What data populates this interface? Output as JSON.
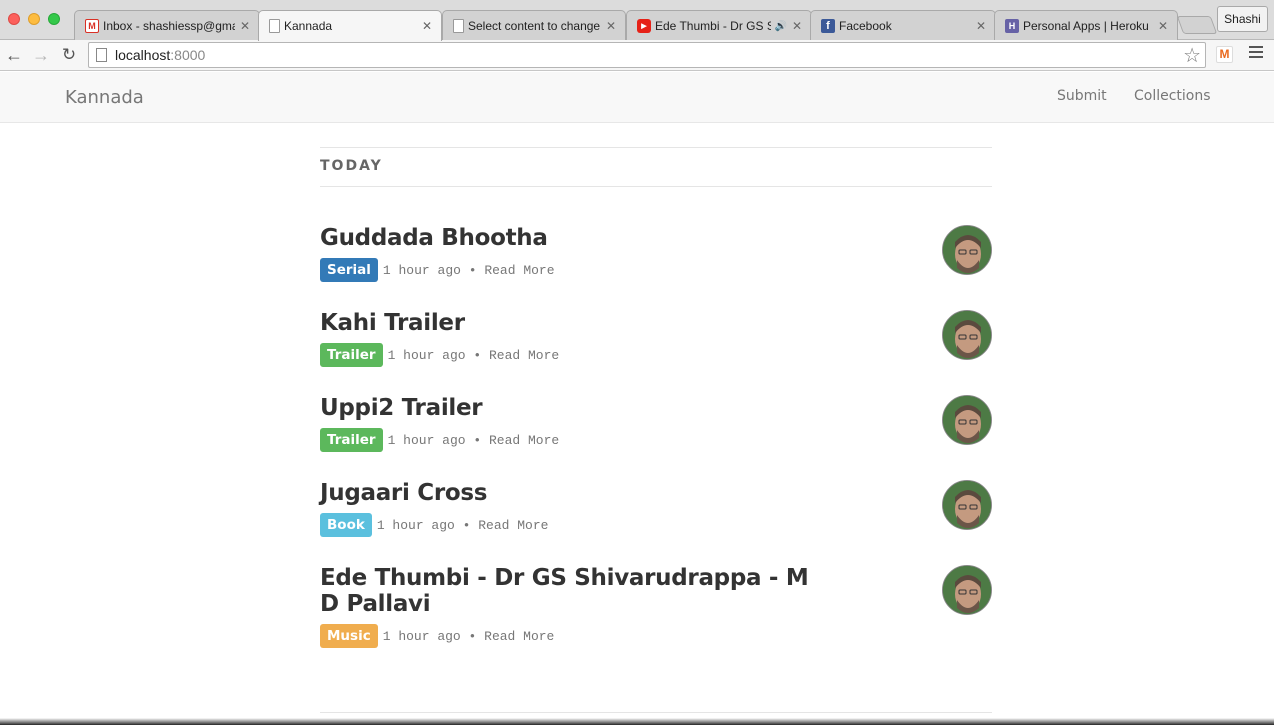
{
  "browser": {
    "tabs": [
      {
        "title": "Inbox - shashiessp@gmail",
        "favicon": "gmail-icon"
      },
      {
        "title": "Kannada",
        "favicon": "page-icon",
        "active": true
      },
      {
        "title": "Select content to change |",
        "favicon": "page-icon"
      },
      {
        "title": "Ede Thumbi - Dr GS Shi",
        "favicon": "youtube-icon",
        "audio": true
      },
      {
        "title": "Facebook",
        "favicon": "facebook-icon"
      },
      {
        "title": "Personal Apps | Heroku",
        "favicon": "heroku-icon"
      }
    ],
    "profile_name": "Shashi",
    "url_host": "localhost",
    "url_port": ":8000",
    "extension_label": "M"
  },
  "site": {
    "brand": "Kannada",
    "nav": {
      "submit": "Submit",
      "collections": "Collections"
    }
  },
  "section": {
    "title": "TODAY"
  },
  "posts": [
    {
      "title": "Guddada Bhootha",
      "label": "Serial",
      "label_color": "#337ab7",
      "time": "1 hour ago",
      "read_more": "Read More"
    },
    {
      "title": "Kahi Trailer",
      "label": "Trailer",
      "label_color": "#5cb85c",
      "time": "1 hour ago",
      "read_more": "Read More"
    },
    {
      "title": "Uppi2 Trailer",
      "label": "Trailer",
      "label_color": "#5cb85c",
      "time": "1 hour ago",
      "read_more": "Read More"
    },
    {
      "title": "Jugaari Cross",
      "label": "Book",
      "label_color": "#5bc0de",
      "time": "1 hour ago",
      "read_more": "Read More"
    },
    {
      "title": "Ede Thumbi - Dr GS Shivarudrappa - M D Pallavi",
      "label": "Music",
      "label_color": "#f0ad4e",
      "time": "1 hour ago",
      "read_more": "Read More"
    }
  ]
}
